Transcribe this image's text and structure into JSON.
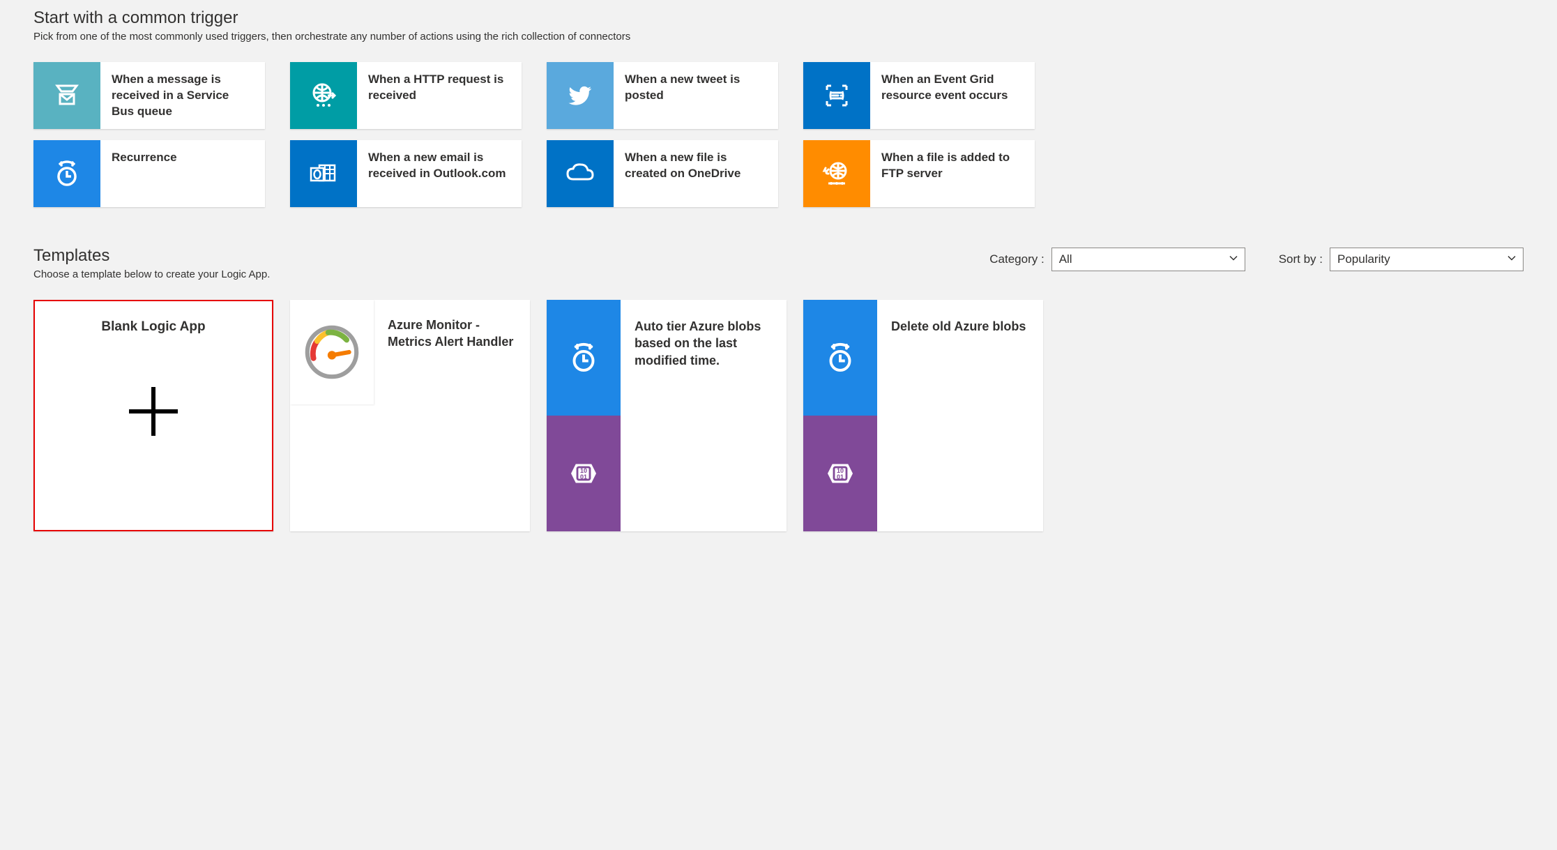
{
  "triggers": {
    "title": "Start with a common trigger",
    "subtitle": "Pick from one of the most commonly used triggers, then orchestrate any number of actions using the rich collection of connectors",
    "items": [
      {
        "icon": "service-bus-icon",
        "label": "When a message is received in a Service Bus queue",
        "color": "#59b2c1"
      },
      {
        "icon": "http-icon",
        "label": "When a HTTP request is received",
        "color": "#009da5"
      },
      {
        "icon": "twitter-icon",
        "label": "When a new tweet is posted",
        "color": "#5aa9dd"
      },
      {
        "icon": "event-grid-icon",
        "label": "When an Event Grid resource event occurs",
        "color": "#0072c6"
      },
      {
        "icon": "recurrence-icon",
        "label": "Recurrence",
        "color": "#1e87e6"
      },
      {
        "icon": "outlook-icon",
        "label": "When a new email is received in Outlook.com",
        "color": "#0072c6"
      },
      {
        "icon": "onedrive-icon",
        "label": "When a new file is created on OneDrive",
        "color": "#0072c6"
      },
      {
        "icon": "ftp-icon",
        "label": "When a file is added to FTP server",
        "color": "#ff8c00"
      }
    ]
  },
  "templates": {
    "title": "Templates",
    "subtitle": "Choose a template below to create your Logic App.",
    "category_label": "Category :",
    "sort_label": "Sort by :",
    "category_value": "All",
    "sort_value": "Popularity",
    "items": [
      {
        "kind": "blank",
        "title": "Blank Logic App",
        "highlight": true
      },
      {
        "kind": "single",
        "title": "Azure Monitor - Metrics Alert Handler",
        "icon": "gauge-icon"
      },
      {
        "kind": "stack",
        "title": "Auto tier Azure blobs based on the last modified time.",
        "tiles": [
          "recurrence-icon",
          "blob-icon"
        ]
      },
      {
        "kind": "stack",
        "title": "Delete old Azure blobs",
        "tiles": [
          "recurrence-icon",
          "blob-icon"
        ]
      }
    ]
  }
}
